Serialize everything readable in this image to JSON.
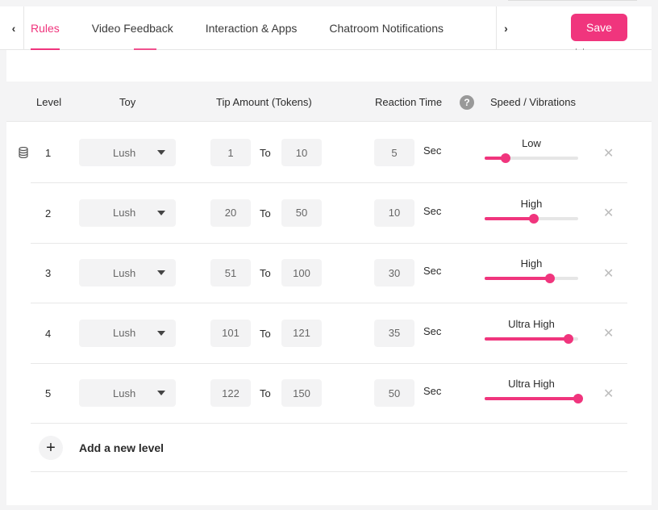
{
  "tabs": [
    "Rules",
    "Video Feedback",
    "Interaction & Apps",
    "Chatroom Notifications"
  ],
  "active_tab": "Rules",
  "save_label": "Save",
  "headers": {
    "level": "Level",
    "toy": "Toy",
    "tip_amount": "Tip Amount (Tokens)",
    "reaction_time": "Reaction Time",
    "speed": "Speed / Vibrations"
  },
  "to_label": "To",
  "sec_label": "Sec",
  "rows": [
    {
      "level": "1",
      "toy": "Lush",
      "from": "1",
      "to": "10",
      "time": "5",
      "speed": "Low",
      "speed_fraction": 0.22
    },
    {
      "level": "2",
      "toy": "Lush",
      "from": "20",
      "to": "50",
      "time": "10",
      "speed": "High",
      "speed_fraction": 0.53
    },
    {
      "level": "3",
      "toy": "Lush",
      "from": "51",
      "to": "100",
      "time": "30",
      "speed": "High",
      "speed_fraction": 0.7
    },
    {
      "level": "4",
      "toy": "Lush",
      "from": "101",
      "to": "121",
      "time": "35",
      "speed": "Ultra High",
      "speed_fraction": 0.9
    },
    {
      "level": "5",
      "toy": "Lush",
      "from": "122",
      "to": "150",
      "time": "50",
      "speed": "Ultra High",
      "speed_fraction": 1.0
    }
  ],
  "add_level_label": "Add a new level",
  "colors": {
    "accent": "#f0357d"
  },
  "icons": {
    "prev": "chevron-left-icon",
    "next": "chevron-right-icon",
    "help": "help-circle-icon",
    "delete": "close-icon",
    "add": "plus-icon",
    "row_marker": "database-icon"
  }
}
